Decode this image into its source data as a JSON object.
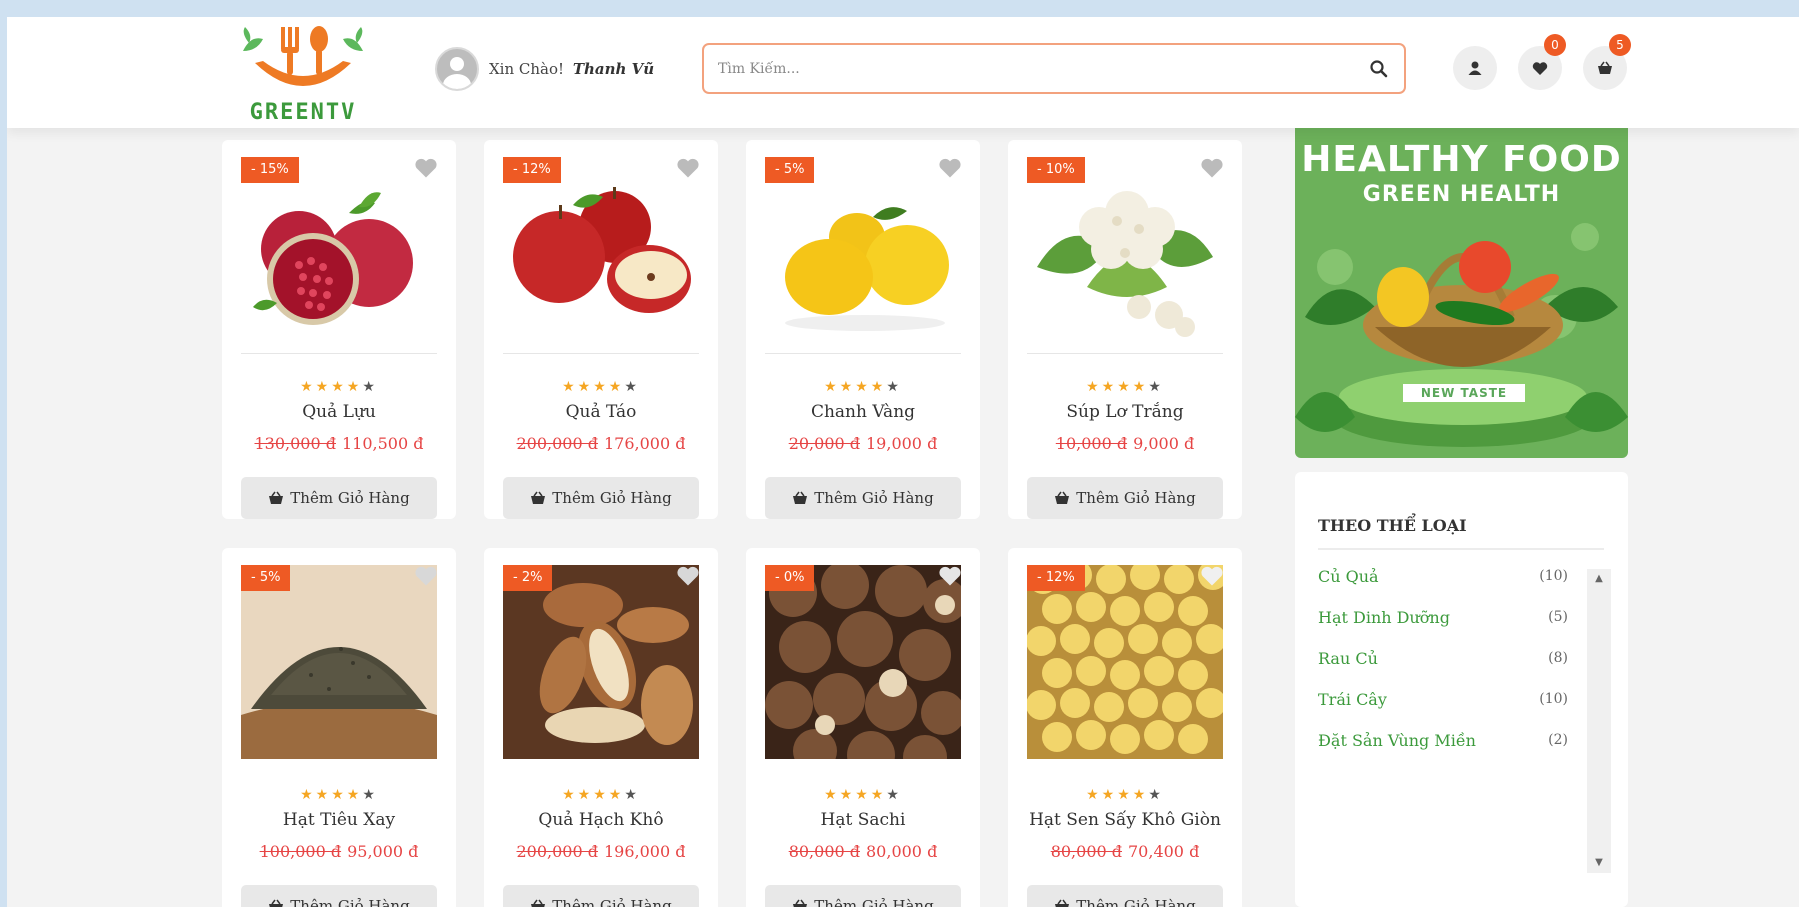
{
  "header": {
    "logo_text": "GREENTV",
    "greeting": "Xin Chào!",
    "user_name": "Thanh Vũ",
    "search_placeholder": "Tìm Kiếm...",
    "wishlist_count": "0",
    "cart_count": "5"
  },
  "colors": {
    "accent": "#ee5a24",
    "green": "#3c9a3c",
    "price": "#e64545",
    "star": "#f5a623"
  },
  "products": [
    {
      "name": "Quả Lựu",
      "discount": "- 15%",
      "old_price": "130,000 đ",
      "new_price": "110,500 đ",
      "rating": 4,
      "button": "Thêm Giỏ Hàng"
    },
    {
      "name": "Quả Táo",
      "discount": "- 12%",
      "old_price": "200,000 đ",
      "new_price": "176,000 đ",
      "rating": 4,
      "button": "Thêm Giỏ Hàng"
    },
    {
      "name": "Chanh Vàng",
      "discount": "- 5%",
      "old_price": "20,000 đ",
      "new_price": "19,000 đ",
      "rating": 4,
      "button": "Thêm Giỏ Hàng"
    },
    {
      "name": "Súp Lơ Trắng",
      "discount": "- 10%",
      "old_price": "10,000 đ",
      "new_price": "9,000 đ",
      "rating": 4,
      "button": "Thêm Giỏ Hàng"
    },
    {
      "name": "Hạt Tiêu Xay",
      "discount": "- 5%",
      "old_price": "100,000 đ",
      "new_price": "95,000 đ",
      "rating": 4,
      "button": "Thêm Giỏ Hàng"
    },
    {
      "name": "Quả Hạch Khô",
      "discount": "- 2%",
      "old_price": "200,000 đ",
      "new_price": "196,000 đ",
      "rating": 4,
      "button": "Thêm Giỏ Hàng"
    },
    {
      "name": "Hạt Sachi",
      "discount": "- 0%",
      "old_price": "80,000 đ",
      "new_price": "80,000 đ",
      "rating": 4,
      "button": "Thêm Giỏ Hàng"
    },
    {
      "name": "Hạt Sen Sấy Khô Giòn",
      "discount": "- 12%",
      "old_price": "80,000 đ",
      "new_price": "70,400 đ",
      "rating": 4,
      "button": "Thêm Giỏ Hàng"
    }
  ],
  "banner": {
    "title": "HEALTHY FOOD",
    "subtitle": "GREEN HEALTH",
    "tag": "NEW TASTE"
  },
  "categories": {
    "title": "THEO THỂ LOẠI",
    "items": [
      {
        "name": "Củ Quả",
        "count": "(10)"
      },
      {
        "name": "Hạt Dinh Dưỡng",
        "count": "(5)"
      },
      {
        "name": "Rau Củ",
        "count": "(8)"
      },
      {
        "name": "Trái Cây",
        "count": "(10)"
      },
      {
        "name": "Đặt Sản Vùng Miền",
        "count": "(2)"
      }
    ]
  }
}
